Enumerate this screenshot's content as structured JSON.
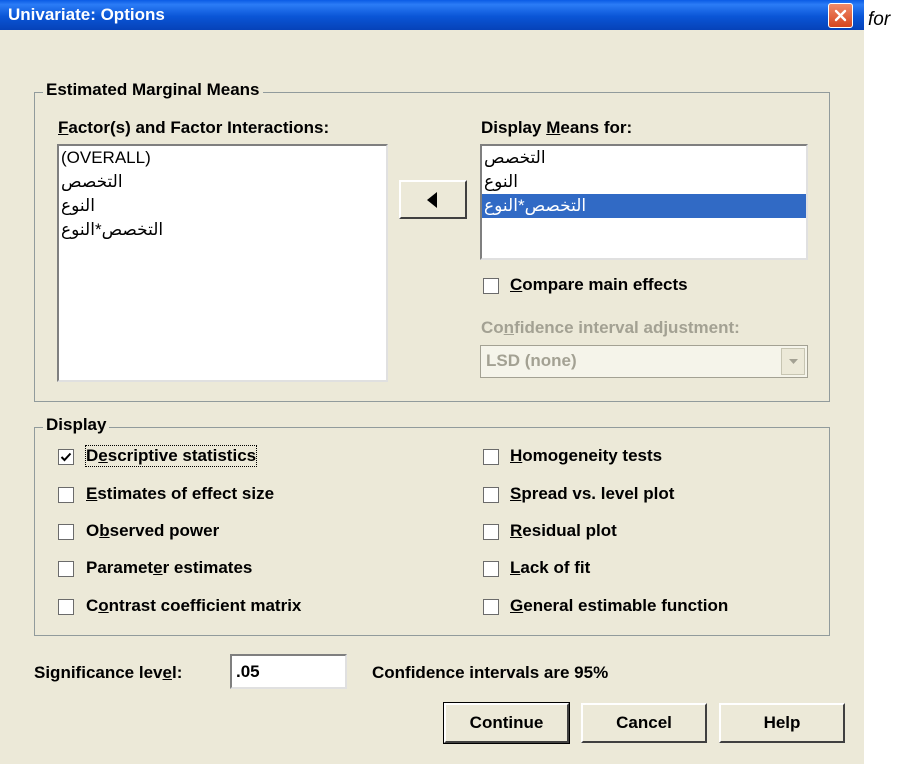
{
  "window": {
    "title": "Univariate: Options",
    "outer_text": "for"
  },
  "marginal_means": {
    "group_label": "Estimated Marginal Means",
    "factors_label": "Factor(s) and Factor Interactions:",
    "factors_items": [
      "(OVERALL)",
      "التخصص",
      "النوع",
      "التخصص*النوع"
    ],
    "display_means_label": "Display Means for:",
    "display_means_items": [
      "التخصص",
      "النوع",
      "التخصص*النوع"
    ],
    "display_means_selected": 2,
    "compare_main_effects": {
      "label": "Compare main effects",
      "checked": false
    },
    "ci_adjustment_label": "Confidence interval adjustment:",
    "ci_adjustment_value": "LSD (none)"
  },
  "display": {
    "group_label": "Display",
    "left": [
      {
        "label": "Descriptive statistics",
        "checked": true
      },
      {
        "label": "Estimates of effect size",
        "checked": false
      },
      {
        "label": "Observed power",
        "checked": false
      },
      {
        "label": "Parameter estimates",
        "checked": false
      },
      {
        "label": "Contrast coefficient matrix",
        "checked": false
      }
    ],
    "right": [
      {
        "label": "Homogeneity tests",
        "checked": false
      },
      {
        "label": "Spread vs. level plot",
        "checked": false
      },
      {
        "label": "Residual plot",
        "checked": false
      },
      {
        "label": "Lack of fit",
        "checked": false
      },
      {
        "label": "General estimable function",
        "checked": false
      }
    ]
  },
  "significance": {
    "label": "Significance level:",
    "value": ".05",
    "ci_text": "Confidence intervals are 95%"
  },
  "buttons": {
    "continue": "Continue",
    "cancel": "Cancel",
    "help": "Help"
  },
  "colors": {
    "titlebar": "#0a55d6",
    "selection": "#316ac5",
    "dialog_bg": "#ece9d8",
    "close": "#d6451e"
  },
  "icons": {
    "close": "close-icon",
    "move_left": "left-arrow-icon",
    "check": "check-icon",
    "dropdown": "chevron-down-icon"
  }
}
